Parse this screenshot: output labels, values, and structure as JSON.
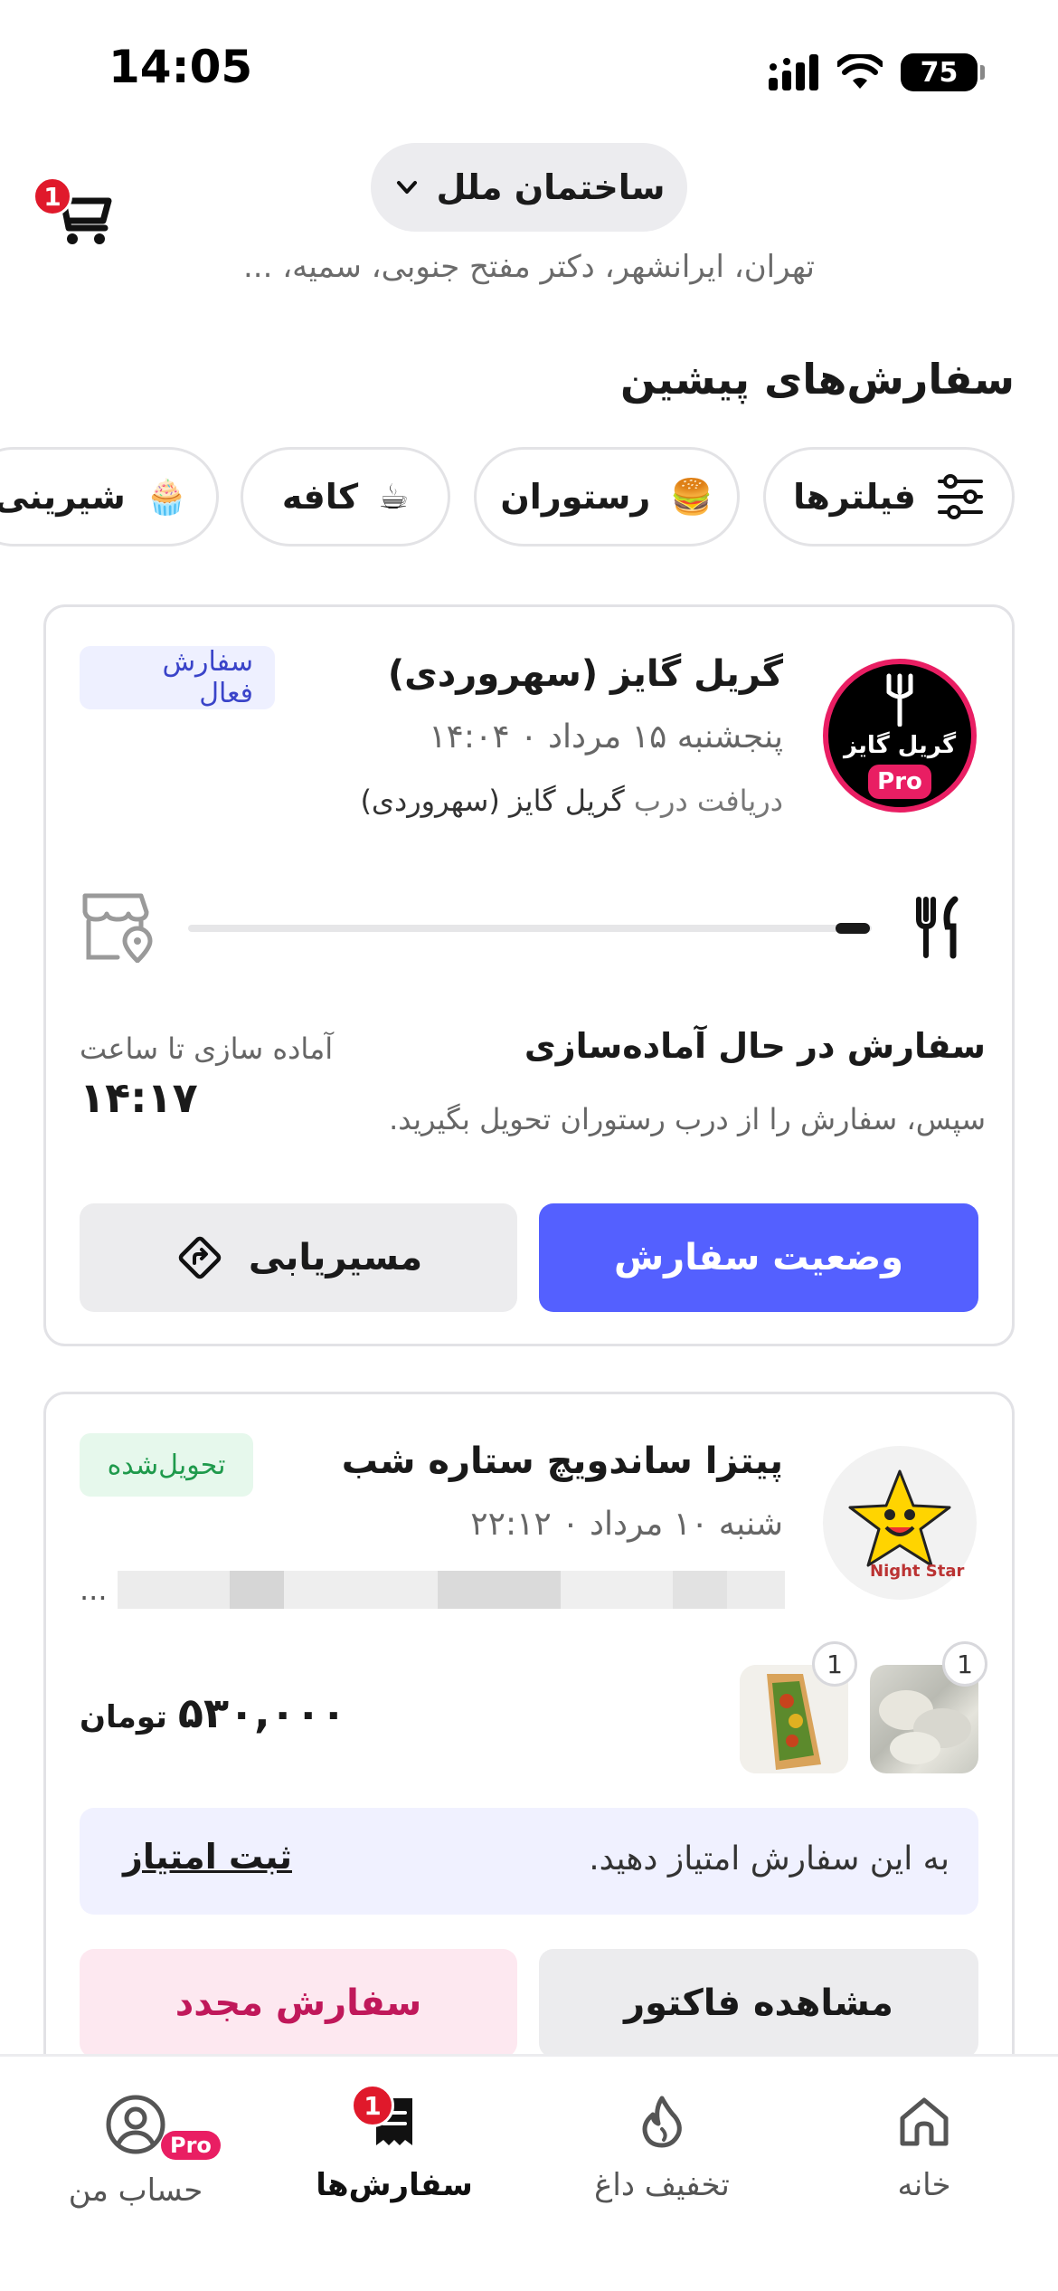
{
  "status_bar": {
    "time": "14:05",
    "battery": "75"
  },
  "header": {
    "location": "ساختمان ملل",
    "address": "تهران، ایرانشهر، دکتر مفتح جنوبی، سمیه، ...",
    "cart_count": "1"
  },
  "section_title": "سفارش‌های پیشین",
  "filters": [
    {
      "label": "فیلترها",
      "icon": "filter-icon"
    },
    {
      "label": "رستوران",
      "icon": "burger-emoji"
    },
    {
      "label": "کافه",
      "icon": "coffee-emoji"
    },
    {
      "label": "شیرینی",
      "icon": "cupcake-emoji"
    }
  ],
  "orders": [
    {
      "restaurant": "گریل گایز (سهروردی)",
      "date": "پنجشنبه ۱۵ مرداد  ۰  ۱۴:۰۴",
      "pickup_prefix": "دریافت درب",
      "pickup_place": "گریل گایز (سهروردی)",
      "status_badge": "سفارش فعال",
      "logo_pro": "Pro",
      "logo_text": "گریل گایز",
      "progress": 0.05,
      "prep_title": "سفارش در حال آماده‌سازی",
      "prep_subtitle": "سپس، سفارش را از درب رستوران تحویل بگیرید.",
      "prep_until_label": "آماده سازی تا ساعت",
      "prep_until_time": "۱۴:۱۷",
      "primary_button": "وضعیت سفارش",
      "secondary_button": "مسیریابی"
    },
    {
      "restaurant": "پیتزا ساندویچ ستاره شب",
      "date": "شنبه ۱۰ مرداد  ۰  ۲۲:۱۲",
      "status_badge": "تحویل‌شده",
      "logo_text": "Night Star",
      "items_ellipsis": "...",
      "item_quantities": [
        "1",
        "1"
      ],
      "price": "۵۳۰,۰۰۰",
      "currency": "تومان",
      "rate_prompt": "به این سفارش امتیاز دهید.",
      "rate_link": "ثبت امتیاز",
      "invoice_button": "مشاهده فاکتور",
      "reorder_button": "سفارش مجدد"
    }
  ],
  "bottom_nav": {
    "home": "خانه",
    "discount": "تخفیف داغ",
    "orders": "سفارش‌ها",
    "orders_badge": "1",
    "account": "حساب من",
    "account_pro": "Pro"
  },
  "colors": {
    "primary": "#5460ff",
    "active_badge_text": "#3a44c9",
    "delivered_badge_text": "#1f9a4c",
    "reorder_text": "#c0185a",
    "notification": "#e0192b"
  }
}
